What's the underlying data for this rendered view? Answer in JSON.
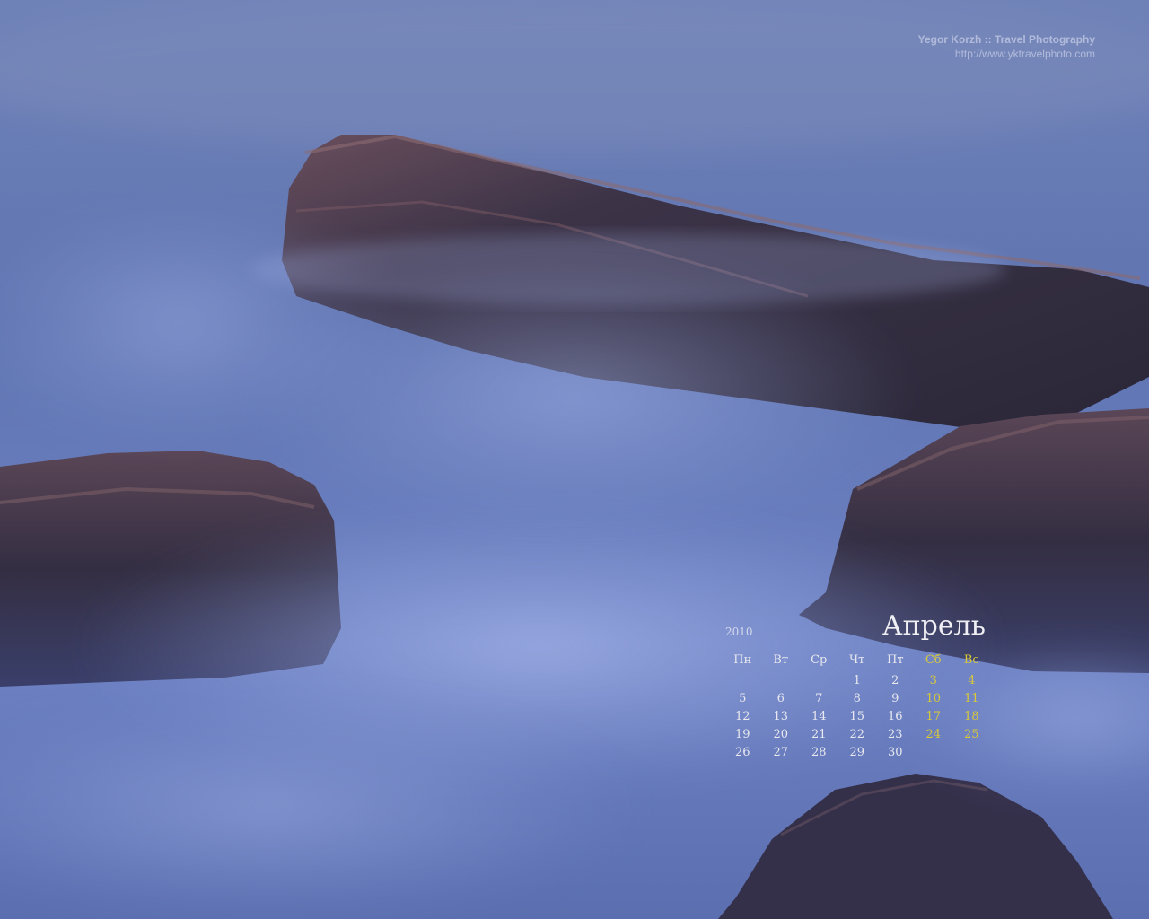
{
  "credit": {
    "name": "Yegor Korzh :: Travel Photography",
    "url": "http://www.yktravelphoto.com"
  },
  "calendar": {
    "year": "2010",
    "month": "Апрель",
    "weekdays": [
      "Пн",
      "Вт",
      "Ср",
      "Чт",
      "Пт",
      "Сб",
      "Вс"
    ],
    "weeks": [
      [
        "",
        "",
        "",
        "1",
        "2",
        "3",
        "4"
      ],
      [
        "5",
        "6",
        "7",
        "8",
        "9",
        "10",
        "11"
      ],
      [
        "12",
        "13",
        "14",
        "15",
        "16",
        "17",
        "18"
      ],
      [
        "19",
        "20",
        "21",
        "22",
        "23",
        "24",
        "25"
      ],
      [
        "26",
        "27",
        "28",
        "29",
        "30",
        "",
        ""
      ]
    ],
    "text_color": "#e8e8ee",
    "weekend_color": "#d9c83a"
  },
  "scene": {
    "subject": "rocks in misty long-exposure sea",
    "palette": {
      "mist": "#7f93cf",
      "deep": "#4a5a96",
      "rock": "#2e2a3c",
      "rock_light": "#6b4d55"
    }
  }
}
